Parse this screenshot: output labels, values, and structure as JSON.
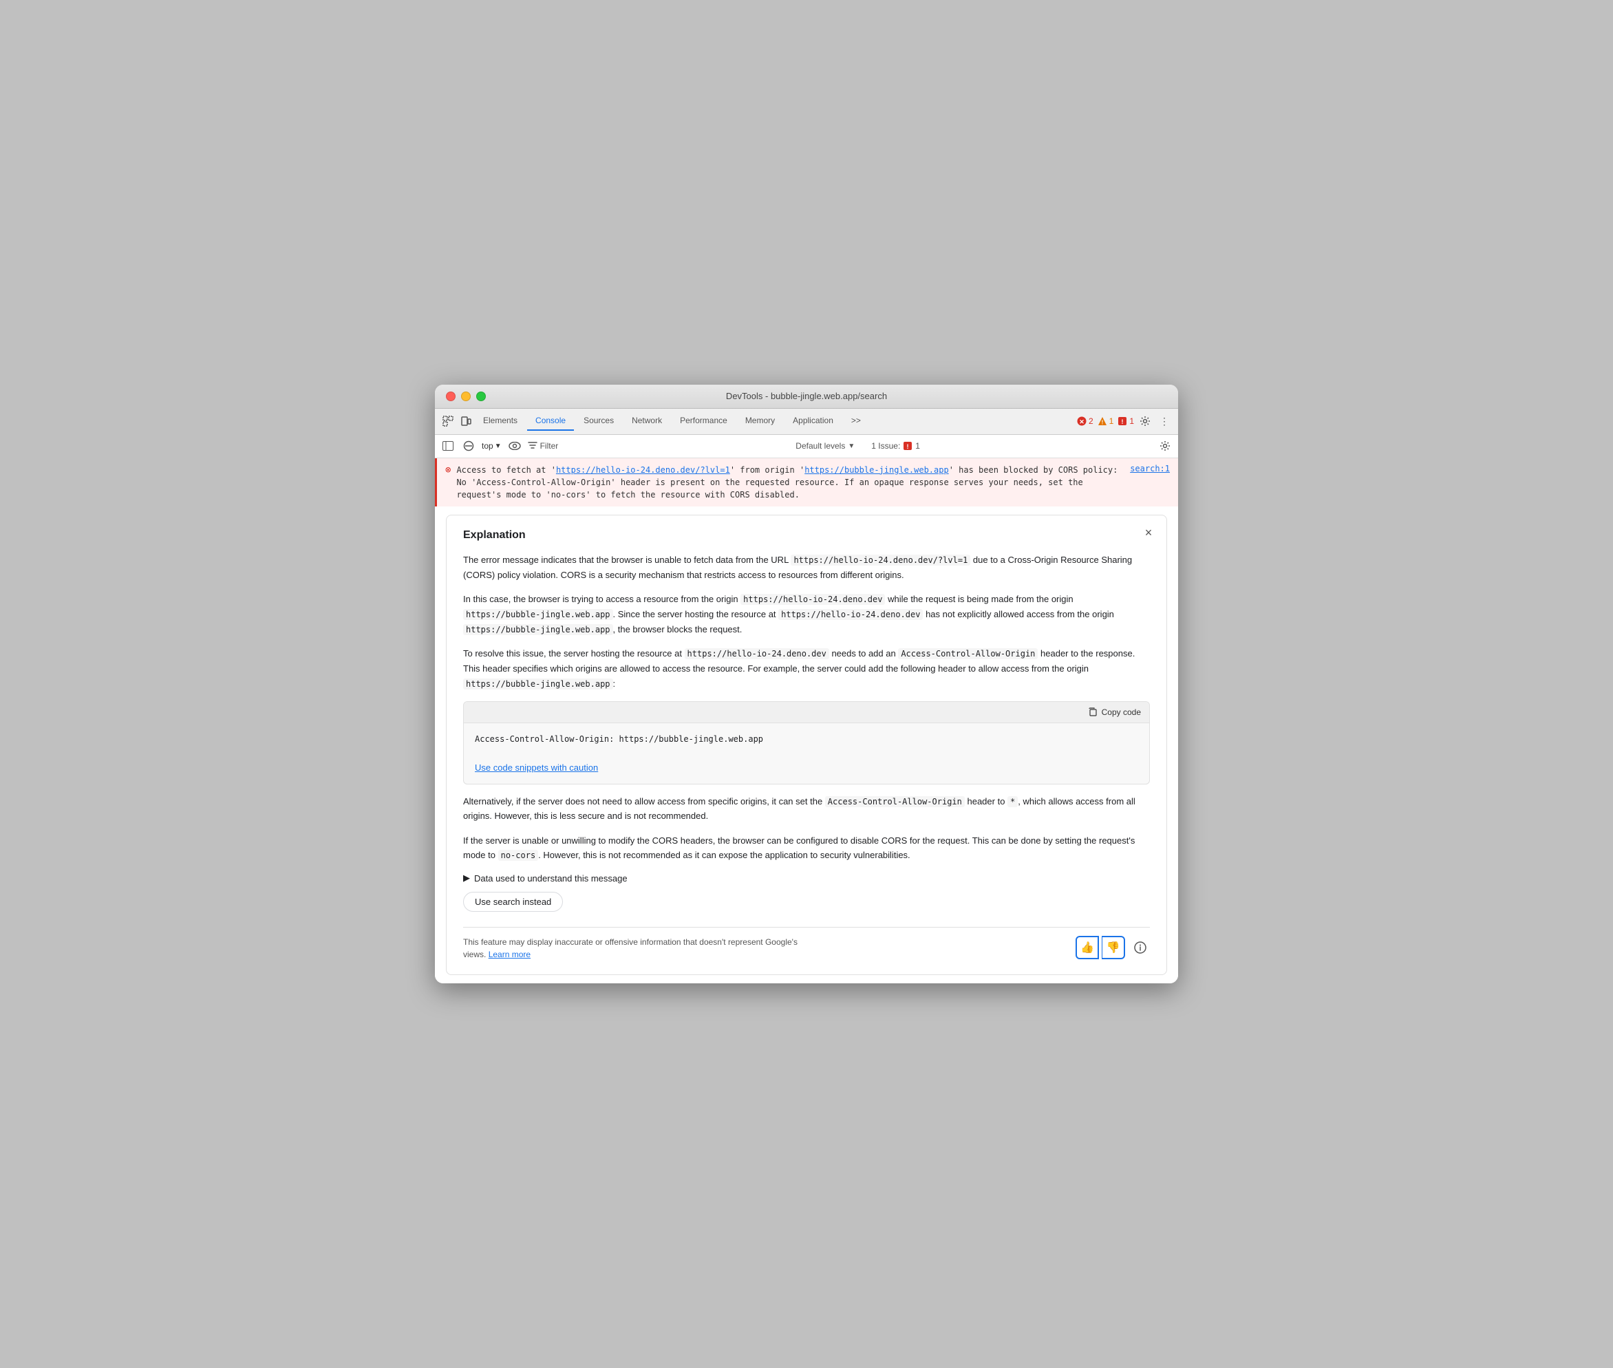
{
  "window": {
    "title": "DevTools - bubble-jingle.web.app/search"
  },
  "tabs": [
    {
      "id": "elements",
      "label": "Elements",
      "active": false
    },
    {
      "id": "console",
      "label": "Console",
      "active": true
    },
    {
      "id": "sources",
      "label": "Sources",
      "active": false
    },
    {
      "id": "network",
      "label": "Network",
      "active": false
    },
    {
      "id": "performance",
      "label": "Performance",
      "active": false
    },
    {
      "id": "memory",
      "label": "Memory",
      "active": false
    },
    {
      "id": "application",
      "label": "Application",
      "active": false
    }
  ],
  "toolbar": {
    "more_label": ">>",
    "error_count": "2",
    "warning_count": "1",
    "info_count": "1"
  },
  "console_toolbar": {
    "top_label": "top",
    "filter_label": "Filter",
    "default_levels": "Default levels",
    "issue_label": "1 Issue:",
    "issue_count": "1"
  },
  "error_message": {
    "text_before_link1": "Access to fetch at '",
    "link1_text": "https://hello-io-24.deno.dev/?lvl=1",
    "link1_href": "https://hello-io-24.deno.dev/?lvl=1",
    "text_between": "' from origin '",
    "link2_text": "https://bubble-jingle.web.app",
    "link2_href": "https://bubble-jingle.web.app",
    "text_after": "' has been blocked by CORS policy: No 'Access-Control-Allow-Origin' header is present on the requested resource. If an opaque response serves your needs, set the request's mode to 'no-cors' to fetch the resource with CORS disabled.",
    "source_link": "search:1"
  },
  "explanation": {
    "title": "Explanation",
    "close_label": "×",
    "paragraph1": "The error message indicates that the browser is unable to fetch data from the URL https://hello-io-24.deno.dev/?lvl=1 due to a Cross-Origin Resource Sharing (CORS) policy violation. CORS is a security mechanism that restricts access to resources from different origins.",
    "paragraph1_url": "https://hello-io-24.deno.dev/?lvl=1",
    "paragraph2_part1": "In this case, the browser is trying to access a resource from the origin ",
    "paragraph2_code1": "https://hello-io-24.deno.dev",
    "paragraph2_part2": " while the request is being made from the origin ",
    "paragraph2_code2": "https://bubble-jingle.web.app",
    "paragraph2_part3": ". Since the server hosting the resource at ",
    "paragraph2_code3": "https://hello-io-24.deno.dev",
    "paragraph2_part4": " has not explicitly allowed access from the origin ",
    "paragraph2_code4": "https://bubble-jingle.web.app",
    "paragraph2_part5": ", the browser blocks the request.",
    "paragraph3_part1": "To resolve this issue, the server hosting the resource at ",
    "paragraph3_code1": "https://hello-io-24.deno.dev",
    "paragraph3_part2": " needs to add an ",
    "paragraph3_code2": "Access-Control-Allow-Origin",
    "paragraph3_part3": " header to the response. This header specifies which origins are allowed to access the resource. For example, the server could add the following header to allow access from the origin ",
    "paragraph3_code3": "https://bubble-jingle.web.app",
    "paragraph3_part4": ":",
    "code_snippet": "Access-Control-Allow-Origin: https://bubble-jingle.web.app",
    "copy_code_label": "Copy code",
    "caution_link": "Use code snippets with caution",
    "paragraph4_part1": "Alternatively, if the server does not need to allow access from specific origins, it can set the ",
    "paragraph4_code1": "Access-Control-Allow-Origin",
    "paragraph4_part2": " header to ",
    "paragraph4_code2": "*",
    "paragraph4_part3": ", which allows access from all origins. However, this is less secure and is not recommended.",
    "paragraph5_part1": "If the server is unable or unwilling to modify the CORS headers, the browser can be configured to disable CORS for the request. This can be done by setting the request's mode to ",
    "paragraph5_code1": "no-cors",
    "paragraph5_part2": ". However, this is not recommended as it can expose the application to security vulnerabilities.",
    "data_used_label": "Data used to understand this message",
    "search_instead_label": "Use search instead",
    "disclaimer_text": "This feature may display inaccurate or offensive information that doesn't represent Google's views.",
    "learn_more_label": "Learn more",
    "thumbs_up_label": "👍",
    "thumbs_down_label": "👎",
    "info_icon_label": "ℹ"
  }
}
